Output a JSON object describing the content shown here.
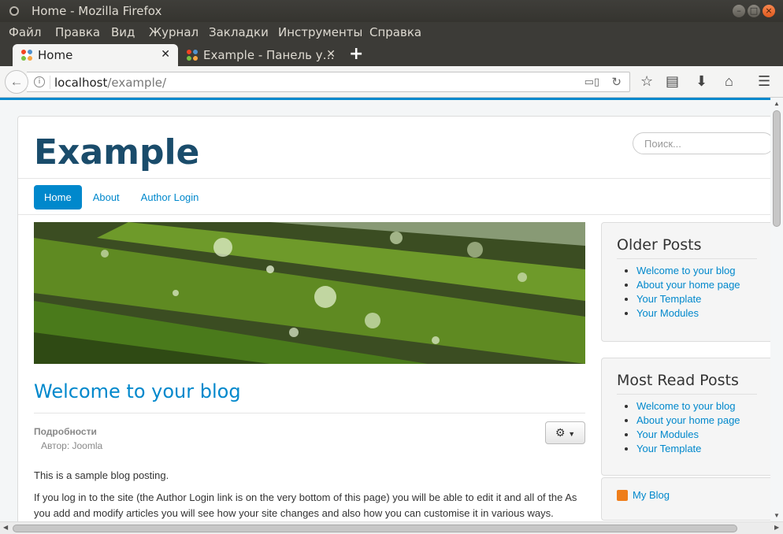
{
  "window": {
    "title": "Home - Mozilla Firefox"
  },
  "menubar": [
    "Файл",
    "Правка",
    "Вид",
    "Журнал",
    "Закладки",
    "Инструменты",
    "Справка"
  ],
  "tabs": [
    {
      "label": "Home",
      "active": true
    },
    {
      "label": "Example - Панель у…",
      "active": false
    }
  ],
  "urlbar": {
    "host": "localhost",
    "path": "/example/"
  },
  "site": {
    "brand": "Example",
    "search_placeholder": "Поиск...",
    "menu": [
      "Home",
      "About",
      "Author Login"
    ]
  },
  "article": {
    "title": "Welcome to your blog",
    "details_heading": "Подробности",
    "author": "Автор: Joomla",
    "para1": "This is a sample blog posting.",
    "para2": "If you log in to the site (the Author Login link is on the very bottom of this page) you will be able to edit it and all of the As you add and modify articles you will see how your site changes and also how you can customise it in various ways."
  },
  "modules": [
    {
      "title": "Older Posts",
      "items": [
        "Welcome to your blog",
        "About your home page",
        "Your Template",
        "Your Modules"
      ]
    },
    {
      "title": "Most Read Posts",
      "items": [
        "Welcome to your blog",
        "About your home page",
        "Your Modules",
        "Your Template"
      ]
    }
  ],
  "feed": {
    "label": "My Blog"
  },
  "colors": {
    "accent": "#0088cc",
    "brand": "#1a4c6b",
    "titlebar": "#3c3b37"
  }
}
